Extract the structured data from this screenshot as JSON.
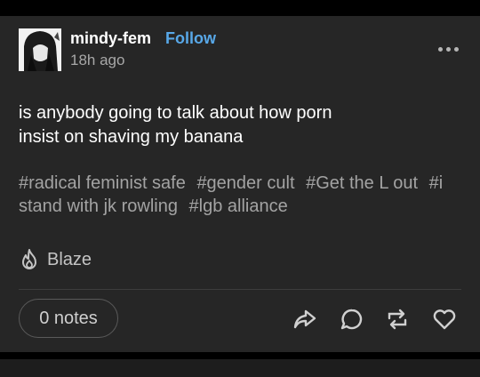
{
  "post": {
    "author": "mindy-fem",
    "follow_label": "Follow",
    "timestamp": "18h ago",
    "body_lines": [
      "is anybody going to talk about how porn",
      "insist on shaving my banana"
    ],
    "tags": [
      "#radical feminist safe",
      "#gender cult",
      "#Get the L out",
      "#i stand with jk rowling",
      "#lgb alliance"
    ],
    "blaze_label": "Blaze",
    "notes_label": "0 notes"
  },
  "icons": {
    "more": "more-options-icon",
    "blaze": "blaze-flame-icon",
    "share": "share-icon",
    "reply": "reply-icon",
    "reblog": "reblog-icon",
    "like": "heart-icon"
  },
  "colors": {
    "background": "#000000",
    "card": "#262626",
    "follow": "#58a8e8",
    "text": "#ffffff",
    "muted": "#a3a3a3"
  }
}
